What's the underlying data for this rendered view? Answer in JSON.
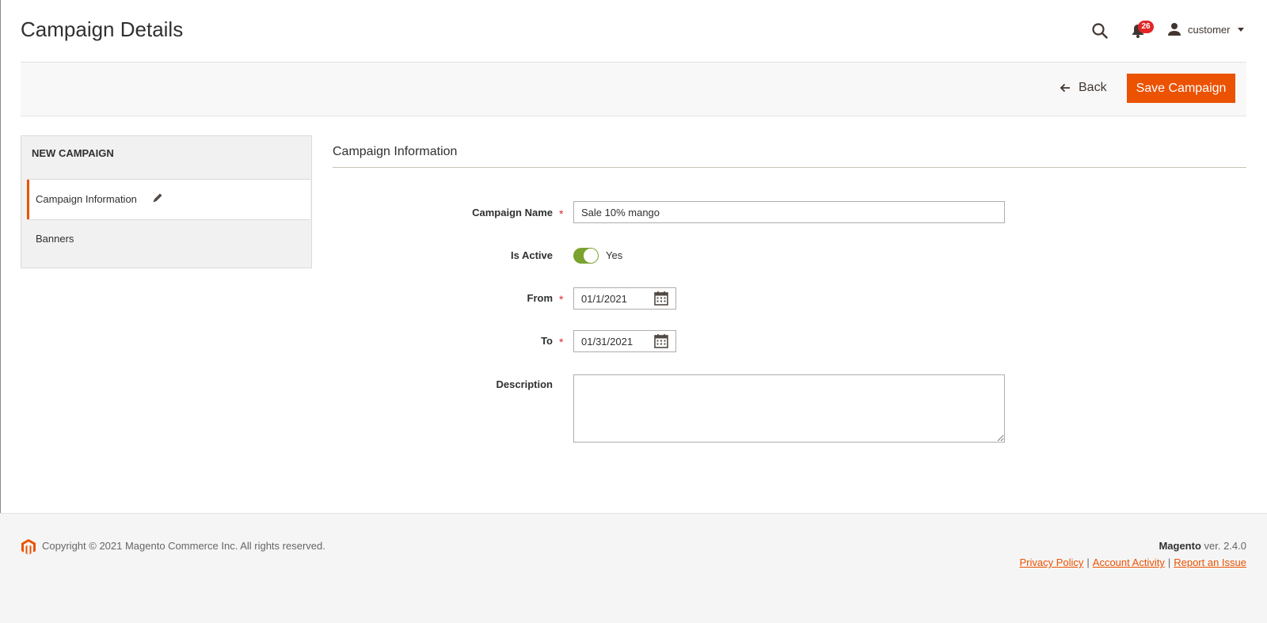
{
  "header": {
    "title": "Campaign Details",
    "notifications_count": "26",
    "user_name": "customer"
  },
  "actions": {
    "back_label": "Back",
    "save_label": "Save Campaign"
  },
  "sidebar": {
    "title": "NEW CAMPAIGN",
    "items": [
      {
        "label": "Campaign Information",
        "active": true
      },
      {
        "label": "Banners",
        "active": false
      }
    ]
  },
  "form": {
    "section_title": "Campaign Information",
    "campaign_name": {
      "label": "Campaign Name",
      "value": "Sale 10% mango"
    },
    "is_active": {
      "label": "Is Active",
      "value_text": "Yes"
    },
    "from": {
      "label": "From",
      "value": "01/1/2021"
    },
    "to": {
      "label": "To",
      "value": "01/31/2021"
    },
    "description": {
      "label": "Description",
      "value": ""
    }
  },
  "footer": {
    "copyright": "Copyright © 2021 Magento Commerce Inc. All rights reserved.",
    "brand": "Magento",
    "version": " ver. 2.4.0",
    "links": [
      "Privacy Policy",
      "Account Activity",
      "Report an Issue"
    ]
  },
  "colors": {
    "accent": "#eb5202",
    "toggle_on": "#79a22e",
    "badge": "#e22626"
  }
}
